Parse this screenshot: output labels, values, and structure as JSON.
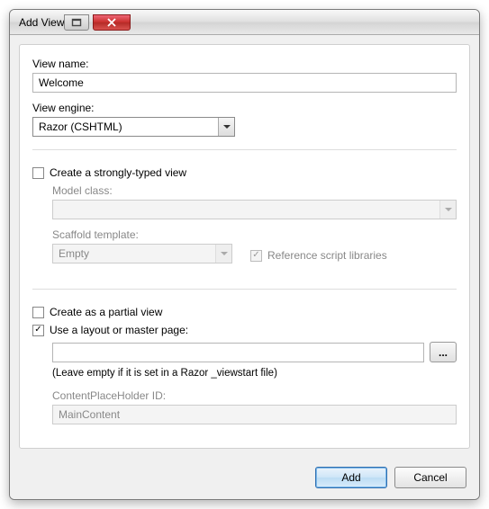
{
  "window": {
    "title": "Add View"
  },
  "labels": {
    "viewName": "View name:",
    "viewEngine": "View engine:",
    "stronglyTyped": "Create a strongly-typed view",
    "modelClass": "Model class:",
    "scaffoldTemplate": "Scaffold template:",
    "refScriptLibs": "Reference script libraries",
    "partialView": "Create as a partial view",
    "useLayout": "Use a layout or master page:",
    "layoutHint": "(Leave empty if it is set in a Razor _viewstart file)",
    "cphId": "ContentPlaceHolder ID:"
  },
  "values": {
    "viewName": "Welcome",
    "viewEngine": "Razor (CSHTML)",
    "modelClass": "",
    "scaffoldTemplate": "Empty",
    "layoutPath": "",
    "cphId": "MainContent"
  },
  "state": {
    "stronglyTypedChecked": false,
    "refScriptLibsChecked": true,
    "partialViewChecked": false,
    "useLayoutChecked": true
  },
  "buttons": {
    "add": "Add",
    "cancel": "Cancel",
    "browse": "..."
  }
}
